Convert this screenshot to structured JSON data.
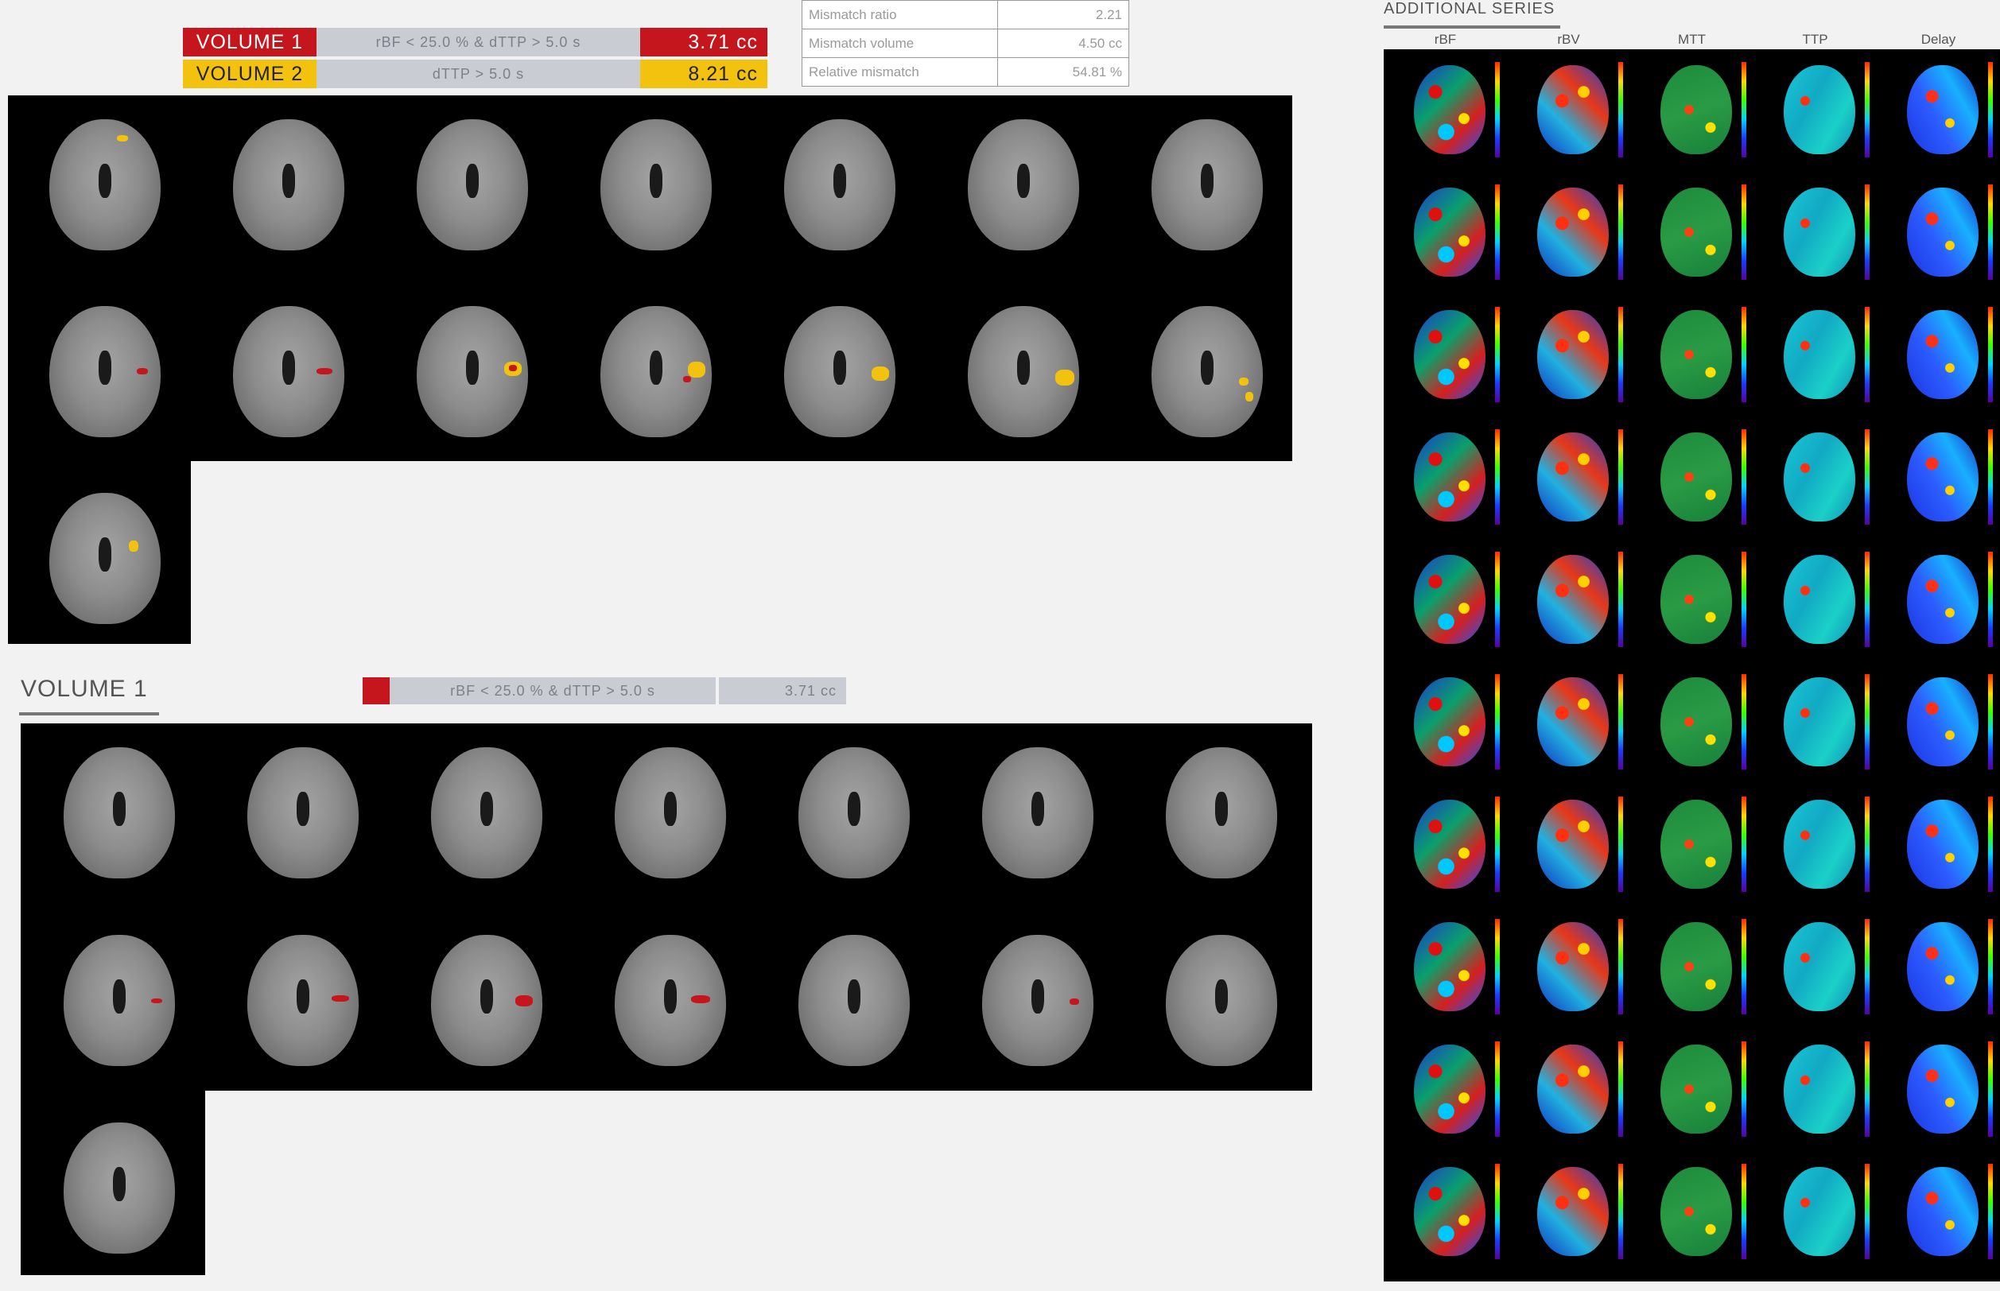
{
  "legend": {
    "volume1": {
      "label": "VOLUME 1",
      "criteria": "rBF < 25.0 % & dTTP > 5.0 s",
      "value": "3.71 cc",
      "color": "#c4161c"
    },
    "volume2": {
      "label": "VOLUME 2",
      "criteria": "dTTP > 5.0 s",
      "value": "8.21 cc",
      "color": "#f3c20f"
    }
  },
  "mismatch": {
    "rows": [
      {
        "label": "Mismatch ratio",
        "value": "2.21"
      },
      {
        "label": "Mismatch volume",
        "value": "4.50 cc"
      },
      {
        "label": "Relative mismatch",
        "value": "54.81 %"
      }
    ]
  },
  "section2": {
    "title": "VOLUME 1",
    "criteria": "rBF < 25.0 % & dTTP > 5.0 s",
    "value": "3.71 cc"
  },
  "additional": {
    "title": "ADDITIONAL SERIES",
    "columns": [
      "rBF",
      "rBV",
      "MTT",
      "TTP",
      "Delay"
    ],
    "rows": 10
  },
  "colors": {
    "panel_bg": "#000000",
    "page_bg": "#f2f2f2",
    "red": "#c4161c",
    "yellow": "#f3c20f",
    "criteria_bg": "#c9ccd2"
  }
}
